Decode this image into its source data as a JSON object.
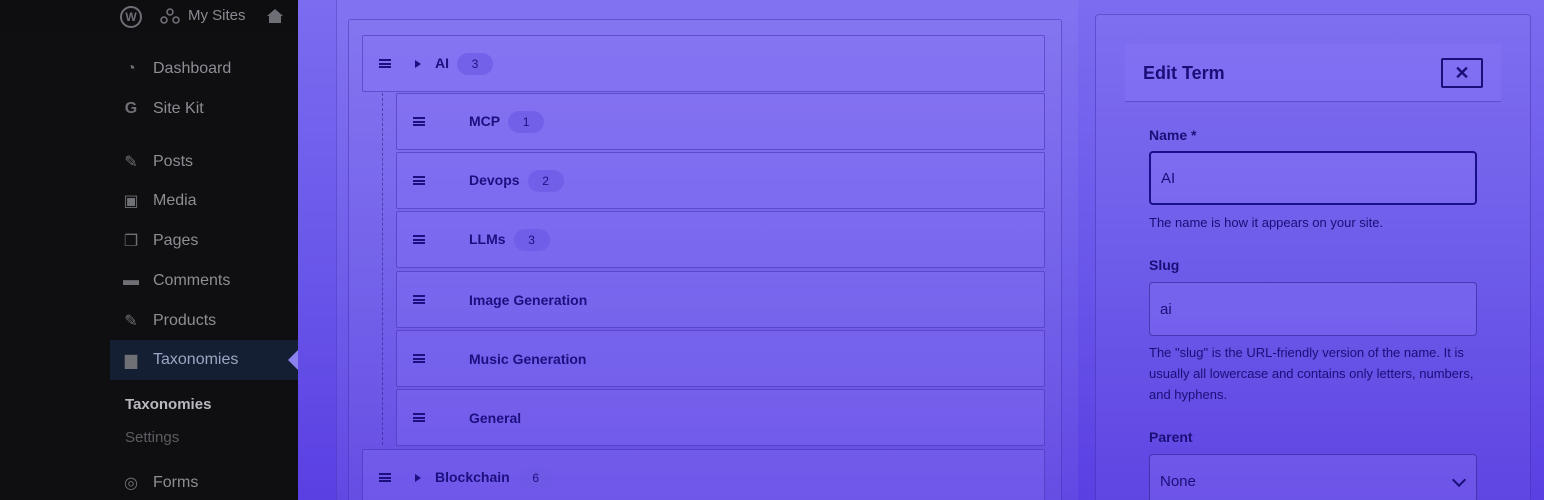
{
  "adminbar": {
    "wp_logo": "W",
    "my_sites": "My Sites",
    "home_icon": "home-icon"
  },
  "sidebar": {
    "items": [
      {
        "label": "Dashboard",
        "icon": "dashboard-icon"
      },
      {
        "label": "Site Kit",
        "icon": "google-icon"
      },
      {
        "label": "Posts",
        "icon": "pin-icon"
      },
      {
        "label": "Media",
        "icon": "media-icon"
      },
      {
        "label": "Pages",
        "icon": "pages-icon"
      },
      {
        "label": "Comments",
        "icon": "comment-icon"
      },
      {
        "label": "Products",
        "icon": "pin-icon"
      },
      {
        "label": "Taxonomies",
        "icon": "folder-icon"
      },
      {
        "label": "Forms",
        "icon": "forms-icon"
      }
    ],
    "submenu": [
      {
        "label": "Taxonomies"
      },
      {
        "label": "Settings"
      }
    ]
  },
  "tree": {
    "rows": [
      {
        "label": "AI",
        "count": "3"
      },
      {
        "label": "MCP",
        "count": "1"
      },
      {
        "label": "Devops",
        "count": "2"
      },
      {
        "label": "LLMs",
        "count": "3"
      },
      {
        "label": "Image Generation",
        "count": null
      },
      {
        "label": "Music Generation",
        "count": null
      },
      {
        "label": "General",
        "count": null
      },
      {
        "label": "Blockchain",
        "count": "6"
      }
    ]
  },
  "edit": {
    "title": "Edit Term",
    "close_label": "✕",
    "name_label": "Name *",
    "name_value": "AI",
    "name_help": "The name is how it appears on your site.",
    "slug_label": "Slug",
    "slug_value": "ai",
    "slug_help": "The \"slug\" is the URL-friendly version of the name. It is usually all lowercase and contains only letters, numbers, and hyphens.",
    "parent_label": "Parent",
    "parent_value": "None"
  }
}
